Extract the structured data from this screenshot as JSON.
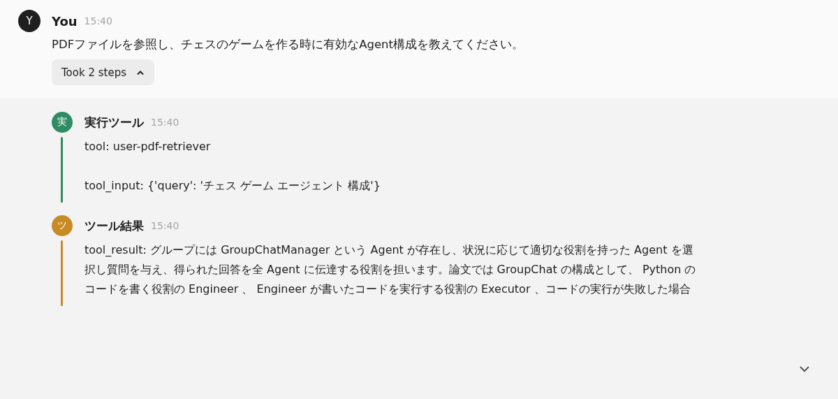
{
  "message": {
    "avatar": "Y",
    "author": "You",
    "time": "15:40",
    "text": "PDFファイルを参照し、チェスのゲームを作る時に有効なAgent構成を教えてください。"
  },
  "steps_toggle": {
    "label": "Took 2 steps",
    "expanded": true
  },
  "steps": [
    {
      "avatar": "実",
      "name": "実行ツール",
      "time": "15:40",
      "color": "#2e8b63",
      "text": "tool: user-pdf-retriever\n\ntool_input: {'query': 'チェス ゲーム エージェント 構成'}"
    },
    {
      "avatar": "ツ",
      "name": "ツール結果",
      "time": "15:40",
      "color": "#c88a25",
      "text": "tool_result: グループには GroupChatManager という Agent が存在し、状況に応じて適切な役割を持った Agent を選択し質問を与え、得られた回答を全 Agent に伝達する役割を担います。論文では GroupChat の構成として、 Python のコードを書く役割の Engineer 、 Engineer が書いたコードを実行する役割の Executor 、コードの実行が失敗した場合"
    }
  ]
}
